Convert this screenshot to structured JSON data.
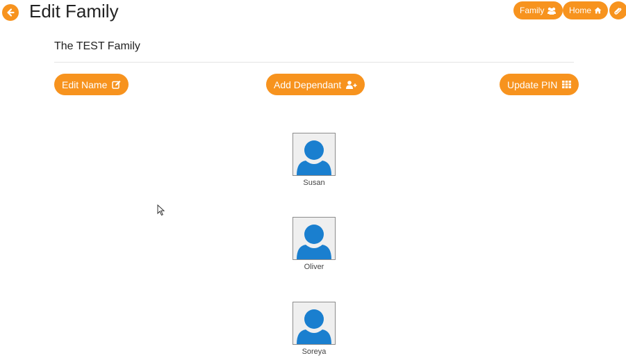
{
  "header": {
    "title": "Edit Family",
    "nav": {
      "family_label": "Family",
      "home_label": "Home"
    }
  },
  "family": {
    "name": "The TEST Family"
  },
  "actions": {
    "edit_name_label": "Edit Name",
    "add_dependant_label": "Add Dependant",
    "update_pin_label": "Update PIN"
  },
  "members": [
    {
      "name": "Susan"
    },
    {
      "name": "Oliver"
    },
    {
      "name": "Soreya"
    }
  ],
  "colors": {
    "accent": "#f7931e",
    "avatar_blue": "#1a7fcf",
    "avatar_bg": "#efefef"
  },
  "icons": {
    "back": "arrow-left-icon",
    "family": "users-icon",
    "home": "home-icon",
    "link": "paperclip-icon",
    "edit_name": "edit-icon",
    "add_dependant": "user-plus-icon",
    "update_pin": "keypad-icon"
  }
}
